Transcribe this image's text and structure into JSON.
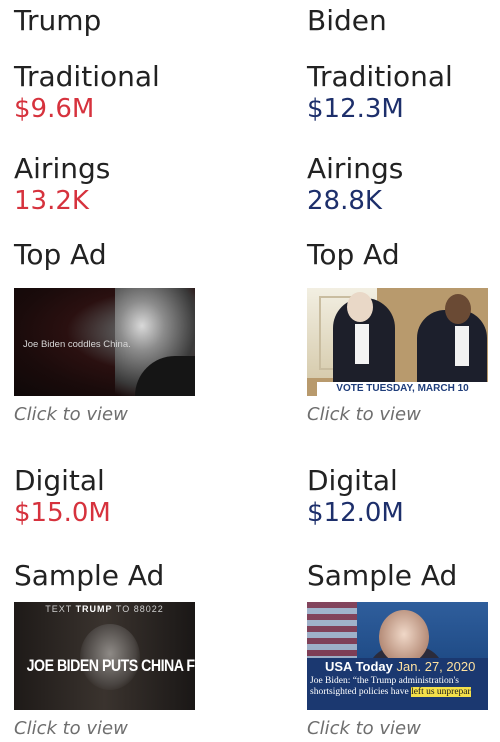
{
  "columns": [
    {
      "name": "Trump",
      "traditional": {
        "label": "Traditional",
        "value": "$9.6M"
      },
      "airings": {
        "label": "Airings",
        "value": "13.2K"
      },
      "top_ad": {
        "label": "Top Ad",
        "caption": "Joe Biden coddles China.",
        "cta": "Click to view"
      },
      "digital": {
        "label": "Digital",
        "value": "$15.0M"
      },
      "sample_ad": {
        "label": "Sample Ad",
        "top_text": [
          "TEXT ",
          "TRUMP",
          " TO 88022"
        ],
        "headline": "JOE BIDEN PUTS CHINA FIRST",
        "cta": "Click to view"
      },
      "color": "#d6323d"
    },
    {
      "name": "Biden",
      "traditional": {
        "label": "Traditional",
        "value": "$12.3M"
      },
      "airings": {
        "label": "Airings",
        "value": "28.8K"
      },
      "top_ad": {
        "label": "Top Ad",
        "banner": "VOTE TUESDAY, MARCH 10",
        "cta": "Click to view"
      },
      "digital": {
        "label": "Digital",
        "value": "$12.0M"
      },
      "sample_ad": {
        "label": "Sample Ad",
        "source": "USA Today",
        "date": "Jan. 27, 2020",
        "quote_1": "Joe Biden: “the Trump administration's",
        "quote_2": "shortsighted policies have ",
        "quote_hl": "left us unprepar",
        "cta": "Click to view"
      },
      "color": "#1d2f6b"
    }
  ]
}
